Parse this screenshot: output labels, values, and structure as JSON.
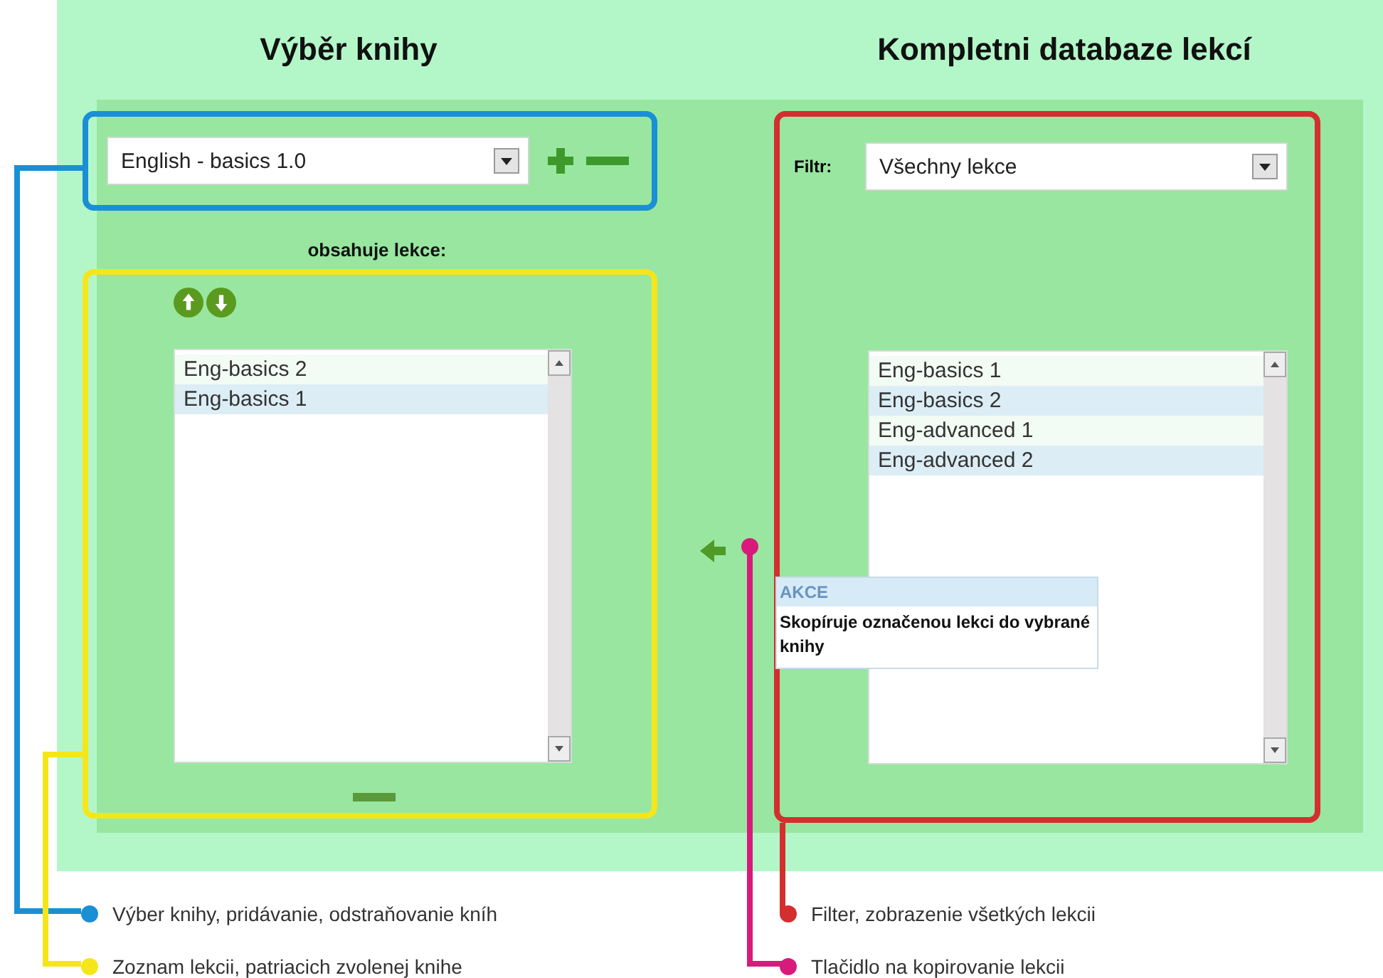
{
  "book_panel": {
    "title": "Výběr knihy",
    "book_select": {
      "value": "English - basics 1.0"
    },
    "lessons_label": "obsahuje lekce:",
    "lessons": [
      {
        "label": "Eng-basics 2"
      },
      {
        "label": "Eng-basics 1"
      }
    ]
  },
  "database_panel": {
    "title": "Kompletni databaze lekcí",
    "filter_label": "Filtr:",
    "filter_select": {
      "value": "Všechny lekce"
    },
    "lessons": [
      {
        "label": "Eng-basics 1"
      },
      {
        "label": "Eng-basics 2"
      },
      {
        "label": "Eng-advanced 1"
      },
      {
        "label": "Eng-advanced 2"
      }
    ]
  },
  "tooltip": {
    "title": "AKCE",
    "text": "Skopíruje označenou lekci do vybrané knihy"
  },
  "legend": [
    {
      "text": "Výber knihy, pridávanie, odstraňovanie kníh",
      "color": "#1a8fd6"
    },
    {
      "text": "Filter, zobrazenie všetkých lekcii",
      "color": "#d32f2f"
    },
    {
      "text": "Zoznam lekcii, patriacich zvolenej knihe",
      "color": "#f5e61a"
    },
    {
      "text": "Tlačidlo na kopirovanie lekcii",
      "color": "#d81b7a"
    }
  ]
}
